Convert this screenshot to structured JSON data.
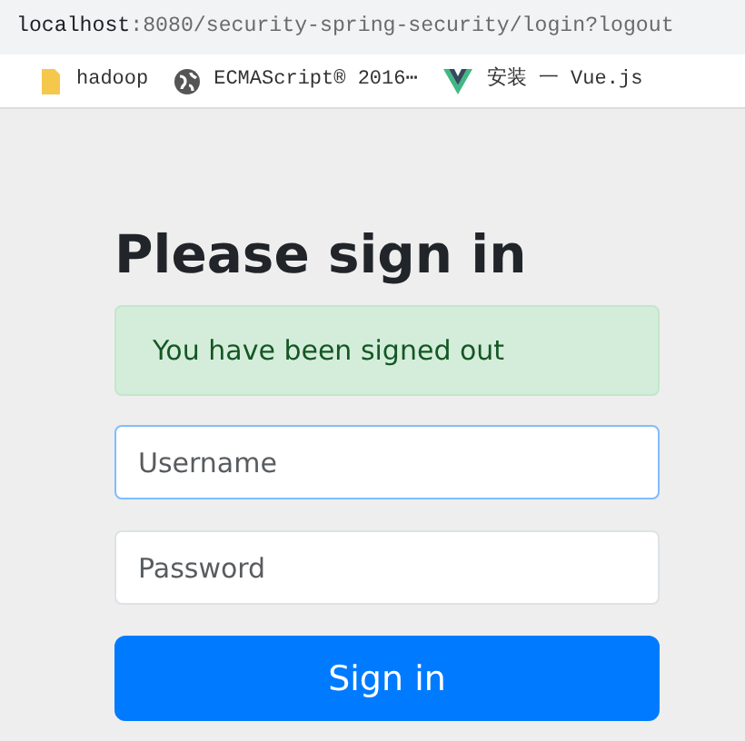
{
  "address_bar": {
    "host": "localhost",
    "path": ":8080/security-spring-security/login?logout"
  },
  "bookmarks": [
    {
      "kind": "folder",
      "label": "hadoop"
    },
    {
      "kind": "globe",
      "label": "ECMAScript® 2016⋯"
    },
    {
      "kind": "vue",
      "label": "安装 一 Vue.js"
    }
  ],
  "heading": "Please sign in",
  "alert": "You have been signed out",
  "fields": [
    {
      "placeholder": "Username",
      "focused": true
    },
    {
      "placeholder": "Password",
      "focused": false
    }
  ],
  "button": "Sign in"
}
